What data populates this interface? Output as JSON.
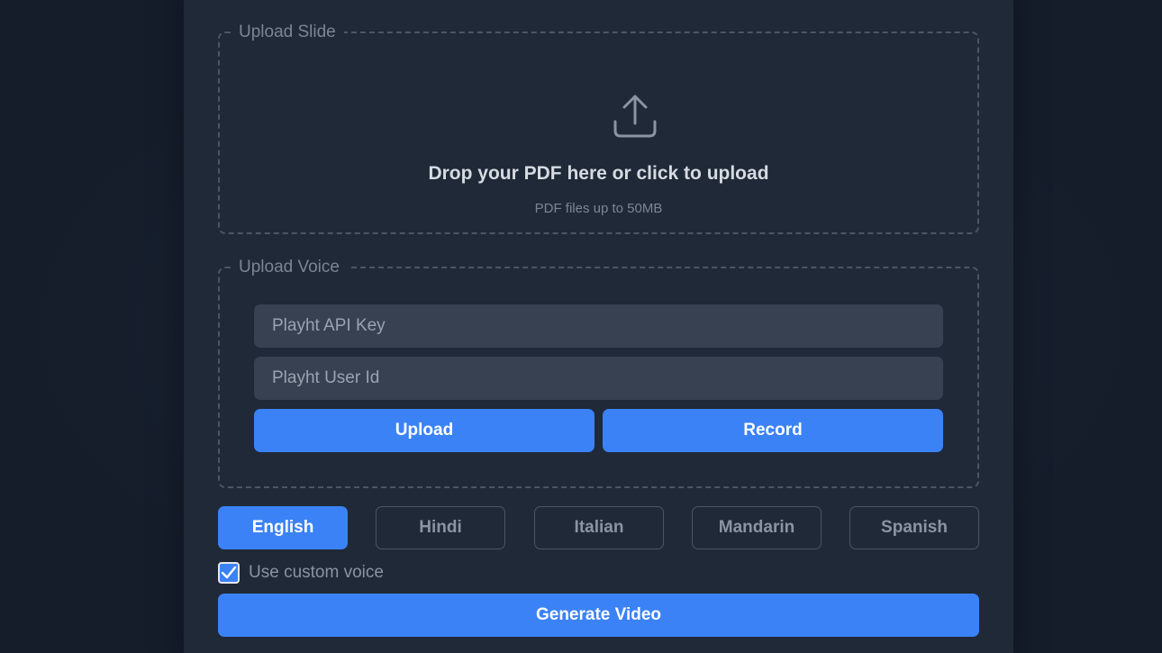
{
  "upload_slide": {
    "legend": "Upload Slide",
    "icon": "upload-icon",
    "title": "Drop your PDF here or click to upload",
    "subtitle": "PDF files up to 50MB"
  },
  "upload_voice": {
    "legend": "Upload Voice",
    "api_key_placeholder": "Playht API Key",
    "user_id_placeholder": "Playht User Id",
    "upload_label": "Upload",
    "record_label": "Record"
  },
  "languages": {
    "selected": "English",
    "items": [
      "English",
      "Hindi",
      "Italian",
      "Mandarin",
      "Spanish"
    ]
  },
  "custom_voice": {
    "label": "Use custom voice",
    "checked": true
  },
  "generate_label": "Generate Video",
  "colors": {
    "background": "#151d2b",
    "card": "#1f2937",
    "accent": "#3b82f6",
    "input": "#374151"
  }
}
